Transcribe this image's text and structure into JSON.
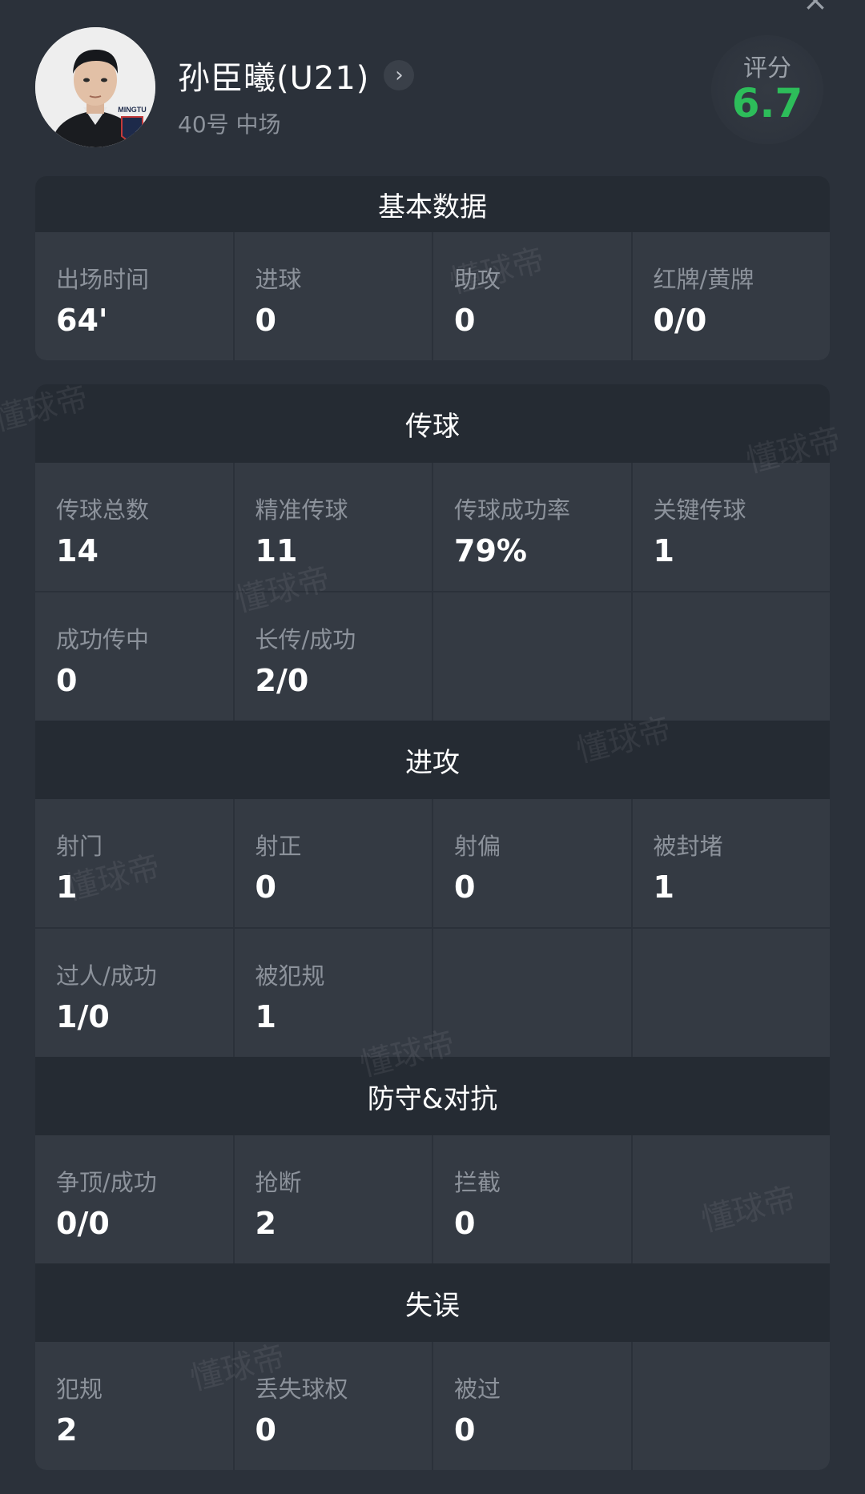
{
  "header": {
    "close_icon": "×",
    "player_name": "孙臣曦(U21)",
    "chevron": "›",
    "player_meta": "40号  中场",
    "rating_label": "评分",
    "rating_value": "6.7",
    "club_badge_text": "MINGTU"
  },
  "watermark_text": "懂球帝",
  "colors": {
    "background": "#2b313a",
    "card": "#343a43",
    "section_header": "#252b33",
    "rating_green": "#2dbd5a",
    "label_gray": "#8c929b"
  },
  "sections": {
    "basic": {
      "title": "基本数据",
      "cells": [
        {
          "label": "出场时间",
          "value": "64'"
        },
        {
          "label": "进球",
          "value": "0"
        },
        {
          "label": "助攻",
          "value": "0"
        },
        {
          "label": "红牌/黄牌",
          "value": "0/0"
        }
      ]
    },
    "passing": {
      "title": "传球",
      "cells": [
        {
          "label": "传球总数",
          "value": "14"
        },
        {
          "label": "精准传球",
          "value": "11"
        },
        {
          "label": "传球成功率",
          "value": "79%"
        },
        {
          "label": "关键传球",
          "value": "1"
        },
        {
          "label": "成功传中",
          "value": "0"
        },
        {
          "label": "长传/成功",
          "value": "2/0"
        }
      ]
    },
    "attack": {
      "title": "进攻",
      "cells": [
        {
          "label": "射门",
          "value": "1"
        },
        {
          "label": "射正",
          "value": "0"
        },
        {
          "label": "射偏",
          "value": "0"
        },
        {
          "label": "被封堵",
          "value": "1"
        },
        {
          "label": "过人/成功",
          "value": "1/0"
        },
        {
          "label": "被犯规",
          "value": "1"
        }
      ]
    },
    "defense": {
      "title": "防守&对抗",
      "cells": [
        {
          "label": "争顶/成功",
          "value": "0/0"
        },
        {
          "label": "抢断",
          "value": "2"
        },
        {
          "label": "拦截",
          "value": "0"
        }
      ]
    },
    "errors": {
      "title": "失误",
      "cells": [
        {
          "label": "犯规",
          "value": "2"
        },
        {
          "label": "丢失球权",
          "value": "0"
        },
        {
          "label": "被过",
          "value": "0"
        }
      ]
    }
  }
}
